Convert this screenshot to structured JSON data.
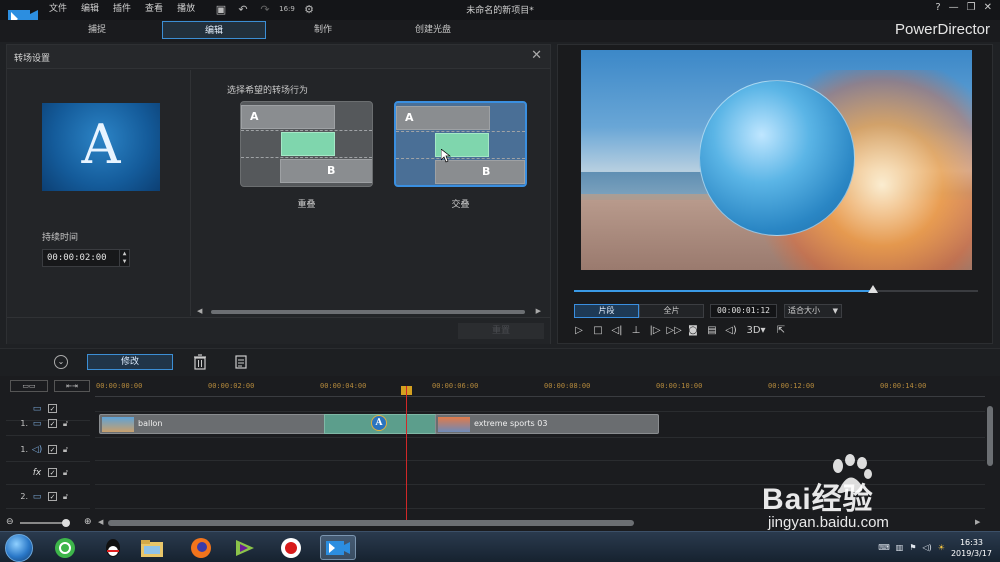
{
  "window": {
    "menus": [
      "文件",
      "编辑",
      "插件",
      "查看",
      "播放"
    ],
    "document_title": "未命名的新项目*",
    "brand": "PowerDirector",
    "controls": [
      "?",
      "—",
      "❐",
      "✕"
    ]
  },
  "mode_tabs": [
    {
      "label": "捕捉",
      "active": false
    },
    {
      "label": "编辑",
      "active": true
    },
    {
      "label": "制作",
      "active": false
    },
    {
      "label": "创建光盘",
      "active": false
    }
  ],
  "transition_panel": {
    "title": "转场设置",
    "preview_letter": "A",
    "duration_label": "持续时间",
    "duration_value": "00:00:02:00",
    "choose_label": "选择希望的转场行为",
    "options": [
      {
        "label": "重叠",
        "selected": false,
        "bar_a": "A",
        "bar_b": "B"
      },
      {
        "label": "交叠",
        "selected": true,
        "bar_a": "A",
        "bar_b": "B"
      }
    ],
    "apply_label": "重置"
  },
  "preview": {
    "segment_tabs": [
      {
        "label": "片段",
        "active": true
      },
      {
        "label": "全片",
        "active": false
      }
    ],
    "timecode": "00:00:01:12",
    "fit_option": "适合大小",
    "threed_label": "3D",
    "progress": 0.74
  },
  "timeline_toolbar": {
    "modify_label": "修改"
  },
  "timeline": {
    "ruler_ticks": [
      "00:00:00:00",
      "00:00:02:00",
      "00:00:04:00",
      "00:00:06:00",
      "00:00:08:00",
      "00:00:10:00",
      "00:00:12:00",
      "00:00:14:00"
    ],
    "tracks": [
      {
        "num": "",
        "symbol": "▭"
      },
      {
        "num": "1.",
        "symbol": "▭"
      },
      {
        "num": "1.",
        "symbol": "◁)"
      },
      {
        "num": "",
        "symbol": "fx"
      },
      {
        "num": "2.",
        "symbol": "▭"
      }
    ],
    "clips": [
      {
        "label": "ballon"
      },
      {
        "label": "extreme sports 03"
      }
    ],
    "transition_badge": "A"
  },
  "taskbar": {
    "time": "16:33",
    "date": "2019/3/17"
  },
  "watermark": {
    "text": "Bai经验",
    "url": "jingyan.baidu.com"
  }
}
